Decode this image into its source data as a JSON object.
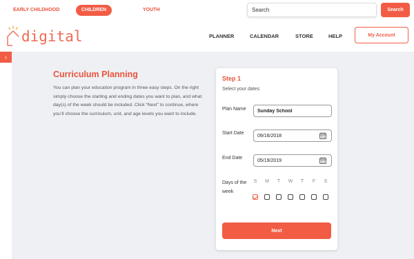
{
  "audience_tabs": [
    {
      "label": "EARLY CHILDHOOD",
      "active": false
    },
    {
      "label": "CHILDREN",
      "active": true
    },
    {
      "label": "YOUTH",
      "active": false
    }
  ],
  "search": {
    "placeholder": "Search",
    "button_label": "Search"
  },
  "logo": {
    "text": "digital",
    "icon": "house-sparkle-icon"
  },
  "nav": {
    "items": [
      {
        "label": "PLANNER"
      },
      {
        "label": "CALENDAR"
      },
      {
        "label": "STORE"
      },
      {
        "label": "HELP"
      }
    ],
    "account_label": "My Account"
  },
  "sidebar": {
    "toggle_icon": "chevron-right-icon",
    "toggle_glyph": "›"
  },
  "intro": {
    "title": "Curriculum Planning",
    "text": "You can plan your education program in three easy steps. On the right simply choose the starting and ending dates you want to plan, and what day(s) of the week should be included. Click “Next” to continue, where you’ll choose the curriculum, unit, and age levels you want to include."
  },
  "form": {
    "step_title": "Step 1",
    "step_subtitle": "Select your dates",
    "plan_name": {
      "label": "Plan Name",
      "value": "Sunday School"
    },
    "start_date": {
      "label": "Start Date",
      "value": "09/16/2018",
      "icon": "calendar-icon"
    },
    "end_date": {
      "label": "End Date",
      "value": "05/19/2019",
      "icon": "calendar-icon"
    },
    "days_label": "Days of the week",
    "days": [
      {
        "letter": "S",
        "checked": true
      },
      {
        "letter": "M",
        "checked": false
      },
      {
        "letter": "T",
        "checked": false
      },
      {
        "letter": "W",
        "checked": false
      },
      {
        "letter": "T",
        "checked": false
      },
      {
        "letter": "F",
        "checked": false
      },
      {
        "letter": "S",
        "checked": false
      }
    ],
    "next_label": "Next"
  },
  "colors": {
    "accent": "#f25c45",
    "background": "#eef0f3"
  }
}
